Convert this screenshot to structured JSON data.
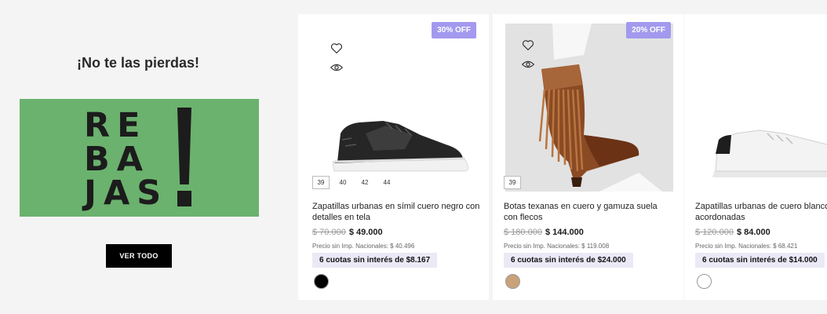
{
  "promo": {
    "title": "¡No te las pierdas!",
    "banner": {
      "line1": "RE",
      "line2": "BA",
      "line3": "JAS",
      "bg_color": "#6bb26e"
    },
    "cta_label": "VER TODO"
  },
  "products": [
    {
      "badge": "30% OFF",
      "sizes": [
        "39",
        "40",
        "42",
        "44"
      ],
      "name": "Zapatillas urbanas en símil cuero negro con detalles en tela",
      "old_price": "$ 70.000",
      "price": "$ 49.000",
      "tax_note": "Precio sin Imp. Nacionales: $ 40.496",
      "installments": "6 cuotas sin interés de $8.167",
      "color": "#000000"
    },
    {
      "badge": "20% OFF",
      "sizes": [
        "39"
      ],
      "name": "Botas texanas en cuero y gamuza suela con flecos",
      "old_price": "$ 180.000",
      "price": "$ 144.000",
      "tax_note": "Precio sin Imp. Nacionales: $ 119.008",
      "installments": "6 cuotas sin interés de $24.000",
      "color": "#c9a27b"
    },
    {
      "name": "Zapatillas urbanas de cuero blanco acordonadas",
      "old_price": "$ 120.000",
      "price": "$ 84.000",
      "tax_note": "Precio sin Imp. Nacionales: $ 68.421",
      "installments": "6 cuotas sin interés de $14.000",
      "color": "#ffffff"
    }
  ],
  "icons": {
    "wishlist": "heart-icon",
    "quick_view": "eye-icon"
  },
  "colors": {
    "badge": "#a399ee",
    "installments_bg": "#ebe9f6",
    "cta_bg": "#000000"
  }
}
